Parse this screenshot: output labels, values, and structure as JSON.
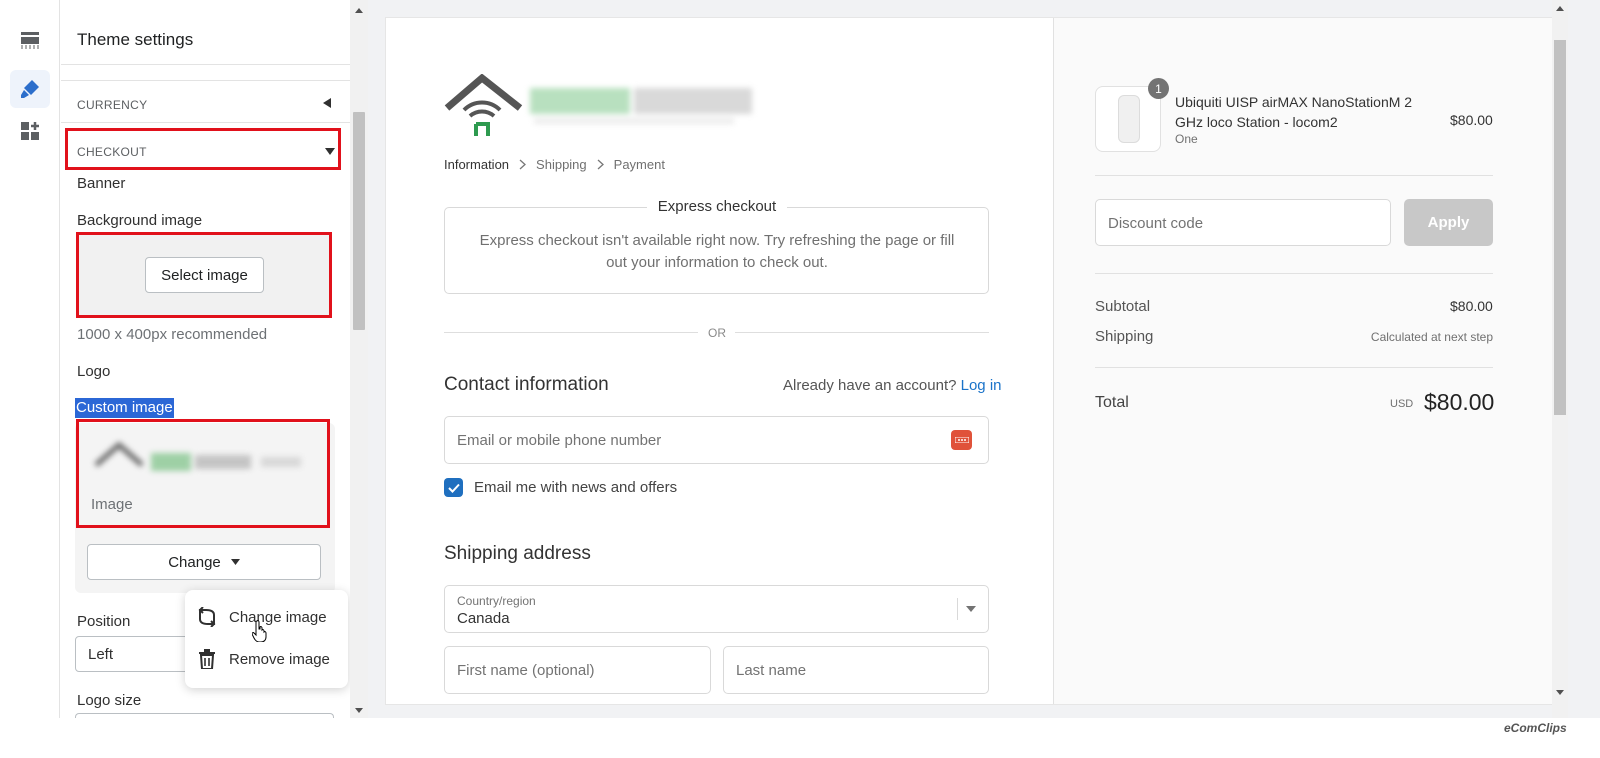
{
  "sidebar": {
    "title": "Theme settings",
    "sections": {
      "currency": "CURRENCY",
      "checkout": "CHECKOUT"
    },
    "banner_label": "Banner",
    "background_image_label": "Background image",
    "select_image_button": "Select image",
    "recommended_text": "1000 x 400px recommended",
    "logo_label": "Logo",
    "custom_image_label": "Custom image",
    "image_caption": "Image",
    "change_button": "Change",
    "position_label": "Position",
    "position_value": "Left",
    "logo_size_label": "Logo size",
    "popup": {
      "change_image": "Change image",
      "remove_image": "Remove image"
    }
  },
  "checkout": {
    "breadcrumb": [
      "Information",
      "Shipping",
      "Payment"
    ],
    "express": {
      "title": "Express checkout",
      "message": "Express checkout isn't available right now. Try refreshing the page or fill out your information to check out."
    },
    "or_text": "OR",
    "contact": {
      "title": "Contact information",
      "account_prompt": "Already have an account?",
      "login_link": "Log in",
      "email_placeholder": "Email or mobile phone number",
      "newsletter_label": "Email me with news and offers",
      "newsletter_checked": true
    },
    "shipping": {
      "title": "Shipping address",
      "country_label": "Country/region",
      "country_value": "Canada",
      "first_name_placeholder": "First name (optional)",
      "last_name_placeholder": "Last name"
    }
  },
  "summary": {
    "product": {
      "quantity_badge": "1",
      "name": "Ubiquiti UISP airMAX NanoStationM 2 GHz loco Station - locom2",
      "variant": "One",
      "price": "$80.00"
    },
    "discount_placeholder": "Discount code",
    "apply_button": "Apply",
    "subtotal_label": "Subtotal",
    "subtotal_value": "$80.00",
    "shipping_label": "Shipping",
    "shipping_value": "Calculated at next step",
    "total_label": "Total",
    "currency_code": "USD",
    "total_value": "$80.00"
  },
  "watermark": "eComClips",
  "colors": {
    "highlight_box": "#e1111b",
    "link": "#1a73c9",
    "checkbox": "#1f6fbf",
    "rail_active_icon": "#2c6ecb"
  }
}
